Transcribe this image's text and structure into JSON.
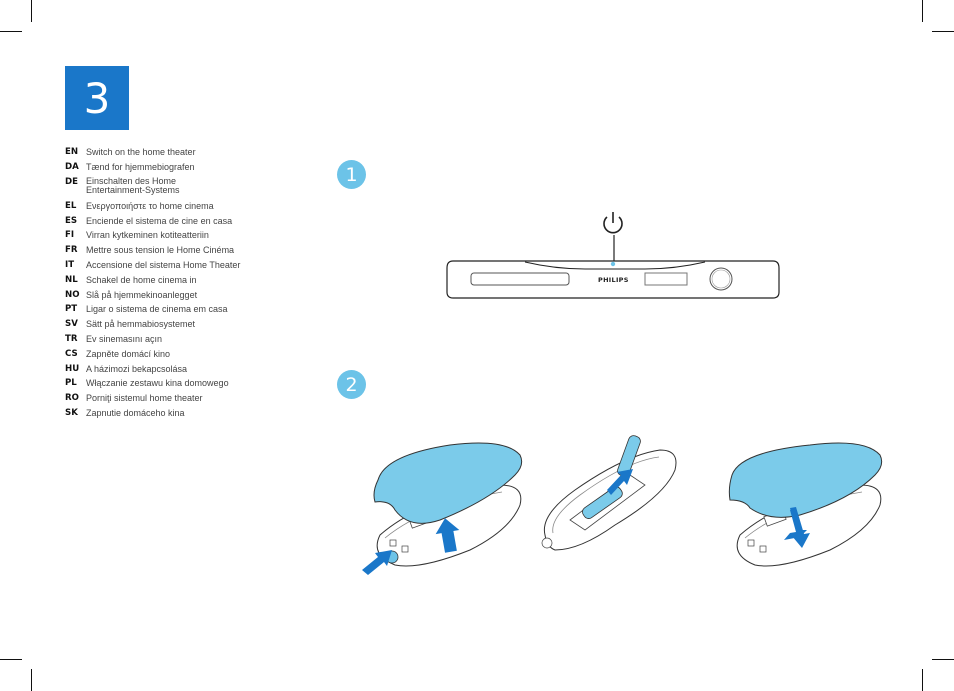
{
  "page": {
    "step_number": "3",
    "accent_color": "#1a77c9",
    "bullet_color": "#6cc3e8",
    "cover_color": "#7bcbea"
  },
  "languages": [
    {
      "code": "EN",
      "text": "Switch on the home theater"
    },
    {
      "code": "DA",
      "text": "Tænd for hjemmebiografen"
    },
    {
      "code": "DE",
      "text": "Einschalten des Home Entertainment-Systems"
    },
    {
      "code": "EL",
      "text": "Ενεργοποιήστε το home cinema"
    },
    {
      "code": "ES",
      "text": "Enciende el sistema de cine en casa"
    },
    {
      "code": "FI",
      "text": "Virran kytkeminen kotiteatteriin"
    },
    {
      "code": "FR",
      "text": "Mettre sous tension le Home Cinéma"
    },
    {
      "code": "IT",
      "text": "Accensione del sistema Home Theater"
    },
    {
      "code": "NL",
      "text": "Schakel de home cinema in"
    },
    {
      "code": "NO",
      "text": "Slå på hjemmekinoanlegget"
    },
    {
      "code": "PT",
      "text": "Ligar o sistema de cinema em casa"
    },
    {
      "code": "SV",
      "text": "Sätt på hemmabiosystemet"
    },
    {
      "code": "TR",
      "text": "Ev sinemasını açın"
    },
    {
      "code": "CS",
      "text": "Zapněte domácí kino"
    },
    {
      "code": "HU",
      "text": "A házimozi bekapcsolása"
    },
    {
      "code": "PL",
      "text": "Włączanie zestawu kina domowego"
    },
    {
      "code": "RO",
      "text": "Porniţi sistemul home theater"
    },
    {
      "code": "SK",
      "text": "Zapnutie domáceho kina"
    }
  ],
  "steps": [
    {
      "number": "1",
      "illustration": "power-button-on-home-theater"
    },
    {
      "number": "2",
      "illustration": "insert-remote-batteries"
    }
  ],
  "device": {
    "brand_label": "PHILIPS",
    "power_icon": "power-icon"
  }
}
